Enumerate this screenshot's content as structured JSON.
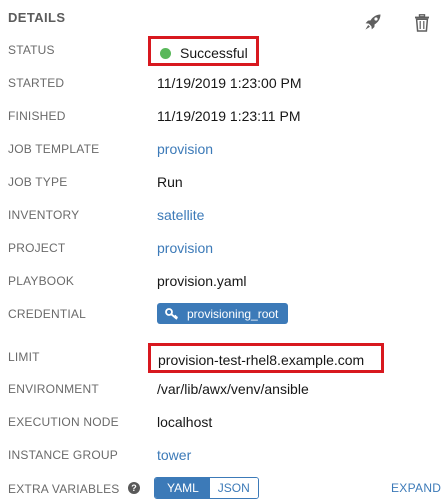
{
  "header": {
    "title": "DETAILS"
  },
  "rows": {
    "status": {
      "label": "STATUS",
      "value": "Successful",
      "status_color": "#59b85a"
    },
    "started": {
      "label": "STARTED",
      "value": "11/19/2019 1:23:00 PM"
    },
    "finished": {
      "label": "FINISHED",
      "value": "11/19/2019 1:23:11 PM"
    },
    "job_template": {
      "label": "JOB TEMPLATE",
      "value": "provision"
    },
    "job_type": {
      "label": "JOB TYPE",
      "value": "Run"
    },
    "inventory": {
      "label": "INVENTORY",
      "value": "satellite"
    },
    "project": {
      "label": "PROJECT",
      "value": "provision"
    },
    "playbook": {
      "label": "PLAYBOOK",
      "value": "provision.yaml"
    },
    "credential": {
      "label": "CREDENTIAL",
      "value": "provisioning_root",
      "icon": "key-icon"
    },
    "limit": {
      "label": "LIMIT",
      "value": "provision-test-rhel8.example.com"
    },
    "environment": {
      "label": "ENVIRONMENT",
      "value": "/var/lib/awx/venv/ansible"
    },
    "execution_node": {
      "label": "EXECUTION NODE",
      "value": "localhost"
    },
    "instance_group": {
      "label": "INSTANCE GROUP",
      "value": "tower"
    },
    "extra_variables": {
      "label": "EXTRA VARIABLES",
      "help": "?",
      "format_options": [
        "YAML",
        "JSON"
      ],
      "selected_format": "YAML",
      "expand_label": "EXPAND"
    }
  },
  "colors": {
    "link": "#3c7ab8",
    "highlight": "#d8181f",
    "success": "#59b85a"
  },
  "icons": {
    "relaunch": "rocket-icon",
    "delete": "trash-icon"
  }
}
